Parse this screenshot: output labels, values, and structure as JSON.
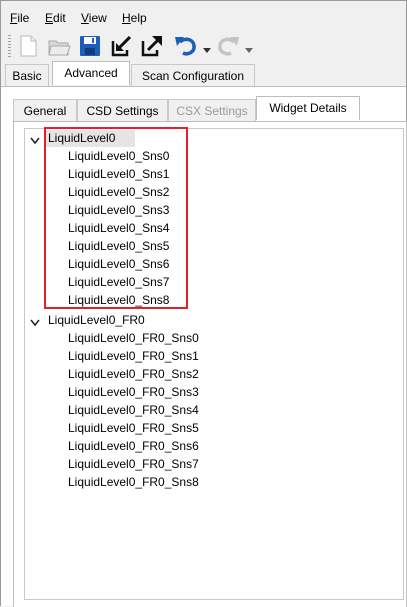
{
  "menu": {
    "file": {
      "u": "F",
      "rest": "ile"
    },
    "edit": {
      "u": "E",
      "rest": "dit"
    },
    "view": {
      "u": "V",
      "rest": "iew"
    },
    "help": {
      "u": "H",
      "rest": "elp"
    }
  },
  "toolbar_icons": [
    "new-icon",
    "open-icon",
    "save-icon",
    "import-icon",
    "export-icon",
    "undo-icon",
    "redo-icon"
  ],
  "outer_tabs": [
    "Basic",
    "Advanced",
    "Scan Configuration"
  ],
  "outer_active": "Advanced",
  "inner_tabs": [
    "General",
    "CSD Settings",
    "CSX Settings",
    "Widget Details"
  ],
  "inner_active": "Widget Details",
  "inner_disabled": "CSX Settings",
  "tree": {
    "widget1": {
      "label": "LiquidLevel0",
      "children": [
        "LiquidLevel0_Sns0",
        "LiquidLevel0_Sns1",
        "LiquidLevel0_Sns2",
        "LiquidLevel0_Sns3",
        "LiquidLevel0_Sns4",
        "LiquidLevel0_Sns5",
        "LiquidLevel0_Sns6",
        "LiquidLevel0_Sns7",
        "LiquidLevel0_Sns8"
      ]
    },
    "widget2": {
      "label": "LiquidLevel0_FR0",
      "children": [
        "LiquidLevel0_FR0_Sns0",
        "LiquidLevel0_FR0_Sns1",
        "LiquidLevel0_FR0_Sns2",
        "LiquidLevel0_FR0_Sns3",
        "LiquidLevel0_FR0_Sns4",
        "LiquidLevel0_FR0_Sns5",
        "LiquidLevel0_FR0_Sns6",
        "LiquidLevel0_FR0_Sns7",
        "LiquidLevel0_FR0_Sns8"
      ]
    }
  },
  "colors": {
    "highlight_box": "#e3202a",
    "selection": "#e5e5e5",
    "icon_blue": "#1d5fb8"
  }
}
